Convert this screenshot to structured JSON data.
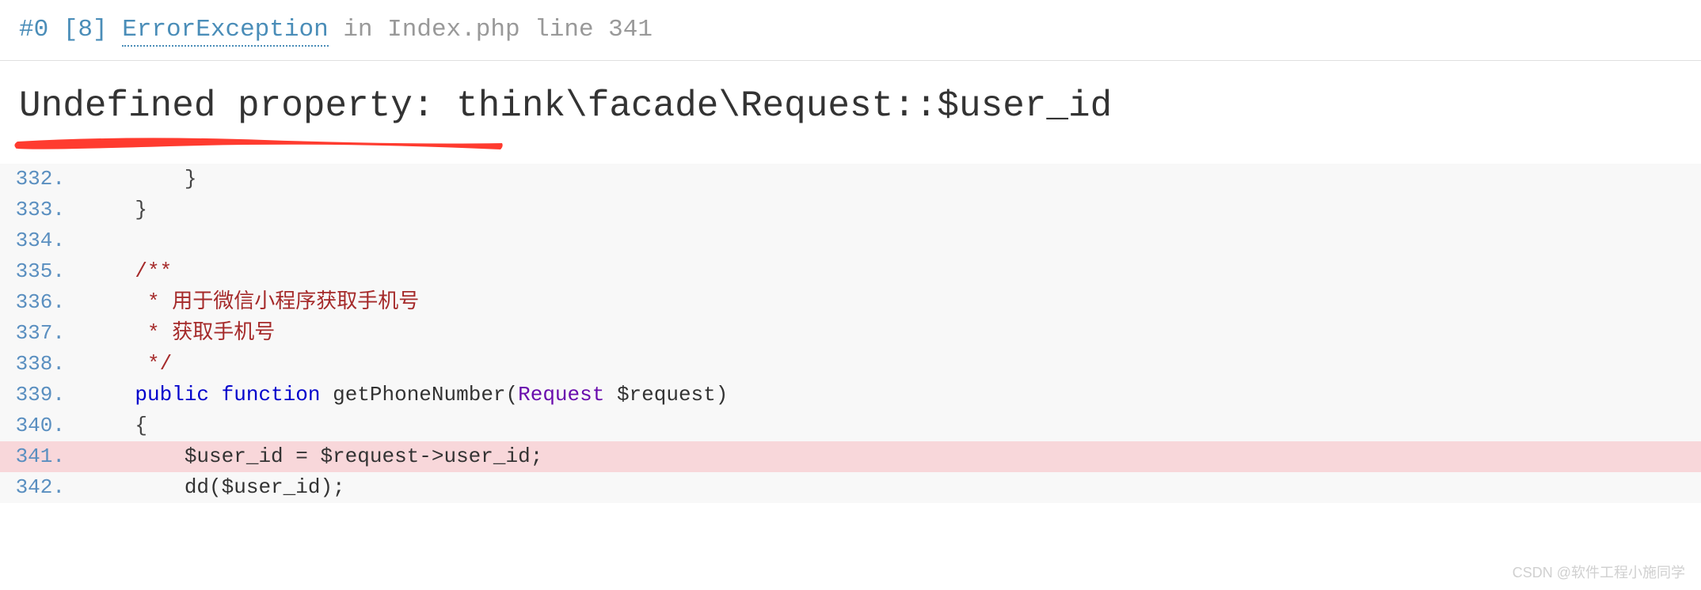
{
  "header": {
    "frame": "#0",
    "error_code": "[8]",
    "exception": "ErrorException",
    "in": "in",
    "location": "Index.php line 341"
  },
  "error_message": "Undefined property: think\\facade\\Request::$user_id",
  "code_lines": [
    {
      "num": "332.",
      "highlighted": false,
      "indent": "        ",
      "tokens": [
        {
          "t": "}",
          "c": "tok-brace"
        }
      ]
    },
    {
      "num": "333.",
      "highlighted": false,
      "indent": "    ",
      "tokens": [
        {
          "t": "}",
          "c": "tok-brace"
        }
      ]
    },
    {
      "num": "334.",
      "highlighted": false,
      "indent": "",
      "tokens": []
    },
    {
      "num": "335.",
      "highlighted": false,
      "indent": "    ",
      "tokens": [
        {
          "t": "/**",
          "c": "tok-comment"
        }
      ]
    },
    {
      "num": "336.",
      "highlighted": false,
      "indent": "     ",
      "tokens": [
        {
          "t": "* 用于微信小程序获取手机号",
          "c": "tok-comment"
        }
      ]
    },
    {
      "num": "337.",
      "highlighted": false,
      "indent": "     ",
      "tokens": [
        {
          "t": "* 获取手机号",
          "c": "tok-comment"
        }
      ]
    },
    {
      "num": "338.",
      "highlighted": false,
      "indent": "     ",
      "tokens": [
        {
          "t": "*/",
          "c": "tok-comment"
        }
      ]
    },
    {
      "num": "339.",
      "highlighted": false,
      "indent": "    ",
      "tokens": [
        {
          "t": "public",
          "c": "tok-keyword"
        },
        {
          "t": " ",
          "c": "tok-default"
        },
        {
          "t": "function",
          "c": "tok-function"
        },
        {
          "t": " getPhoneNumber(",
          "c": "tok-default"
        },
        {
          "t": "Request",
          "c": "tok-type"
        },
        {
          "t": " $request)",
          "c": "tok-default"
        }
      ]
    },
    {
      "num": "340.",
      "highlighted": false,
      "indent": "    ",
      "tokens": [
        {
          "t": "{",
          "c": "tok-brace"
        }
      ]
    },
    {
      "num": "341.",
      "highlighted": true,
      "indent": "        ",
      "tokens": [
        {
          "t": "$user_id = $request->user_id;",
          "c": "tok-default"
        }
      ]
    },
    {
      "num": "342.",
      "highlighted": false,
      "indent": "        ",
      "tokens": [
        {
          "t": "dd($user_id);",
          "c": "tok-default"
        }
      ]
    }
  ],
  "watermark": "CSDN @软件工程小施同学"
}
